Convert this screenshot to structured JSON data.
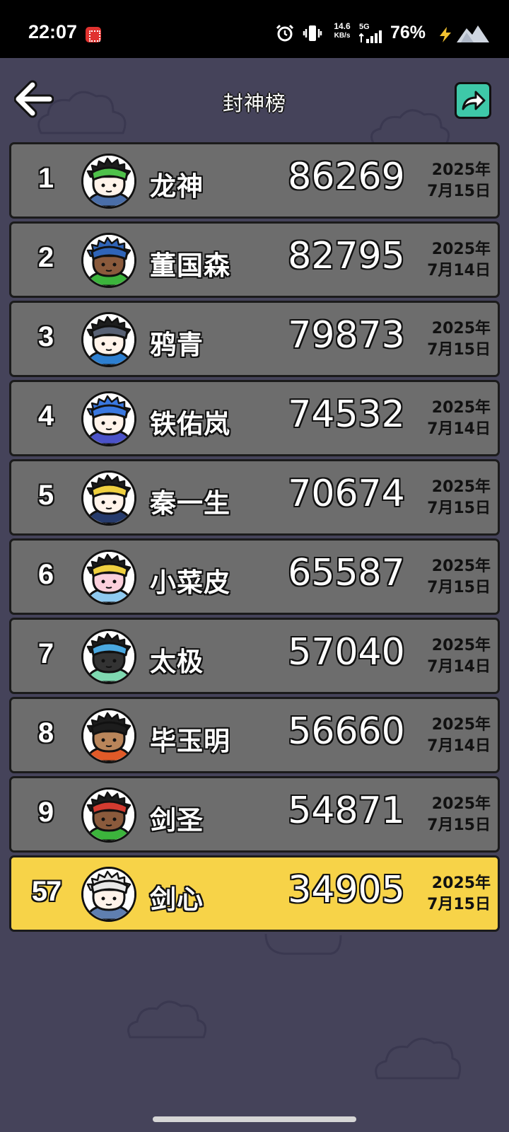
{
  "status_bar": {
    "time": "22:07",
    "net_speed_value": "14.6",
    "net_speed_unit": "KB/s",
    "network": "5G",
    "battery": "76%"
  },
  "header": {
    "title": "封神榜"
  },
  "rankings": [
    {
      "rank": "1",
      "name": "龙神",
      "score": "86269",
      "date_year": "2025年",
      "date_day": "7月15日",
      "avatar": {
        "hat": "#4fc14a",
        "skin": "#fff3ea",
        "hair": "#1d1d1d",
        "body": "#4a6ea8"
      }
    },
    {
      "rank": "2",
      "name": "董国森",
      "score": "82795",
      "date_year": "2025年",
      "date_day": "7月14日",
      "avatar": {
        "hat": "#2f64b8",
        "skin": "#8a5a3c",
        "hair": "#2f64b8",
        "body": "#3cb43c"
      }
    },
    {
      "rank": "3",
      "name": "鸦青",
      "score": "79873",
      "date_year": "2025年",
      "date_day": "7月15日",
      "avatar": {
        "hat": "#586174",
        "skin": "#fff3ea",
        "hair": "#1d1d1d",
        "body": "#2d7fd0"
      }
    },
    {
      "rank": "4",
      "name": "铁佑岚",
      "score": "74532",
      "date_year": "2025年",
      "date_day": "7月14日",
      "avatar": {
        "hat": "#3a78e0",
        "skin": "#fff3ea",
        "hair": "#3a78e0",
        "body": "#4b52c8"
      }
    },
    {
      "rank": "5",
      "name": "秦一生",
      "score": "70674",
      "date_year": "2025年",
      "date_day": "7月15日",
      "avatar": {
        "hat": "#f0d040",
        "skin": "#fff3ea",
        "hair": "#1d1d1d",
        "body": "#263b6c"
      }
    },
    {
      "rank": "6",
      "name": "小菜皮",
      "score": "65587",
      "date_year": "2025年",
      "date_day": "7月15日",
      "avatar": {
        "hat": "#f0d040",
        "skin": "#fbd0dc",
        "hair": "#1d1d1d",
        "body": "#8ec9f0"
      }
    },
    {
      "rank": "7",
      "name": "太极",
      "score": "57040",
      "date_year": "2025年",
      "date_day": "7月14日",
      "avatar": {
        "hat": "#4aa8e0",
        "skin": "#333333",
        "hair": "#1d1d1d",
        "body": "#7ed8b0"
      }
    },
    {
      "rank": "8",
      "name": "毕玉明",
      "score": "56660",
      "date_year": "2025年",
      "date_day": "7月14日",
      "avatar": {
        "hat": "#1d1d1d",
        "skin": "#b9855a",
        "hair": "#1d1d1d",
        "body": "#e05a28"
      }
    },
    {
      "rank": "9",
      "name": "剑圣",
      "score": "54871",
      "date_year": "2025年",
      "date_day": "7月15日",
      "avatar": {
        "hat": "#d33b30",
        "skin": "#8a5a3c",
        "hair": "#1d1d1d",
        "body": "#3cb43c"
      }
    },
    {
      "rank": "57",
      "name": "剑心",
      "score": "34905",
      "date_year": "2025年",
      "date_day": "7月15日",
      "is_current_user": true,
      "avatar": {
        "hat": "#e8e8e8",
        "skin": "#fff3ea",
        "hair": "#e8e8e8",
        "body": "#5f7fb0"
      }
    }
  ],
  "colors": {
    "background": "#45435a",
    "row": "#6d6d6d",
    "row_current_user": "#f7d348",
    "share_button": "#3ec8a8"
  },
  "icons": {
    "back": "back-arrow-icon",
    "share": "share-arrow-icon"
  }
}
